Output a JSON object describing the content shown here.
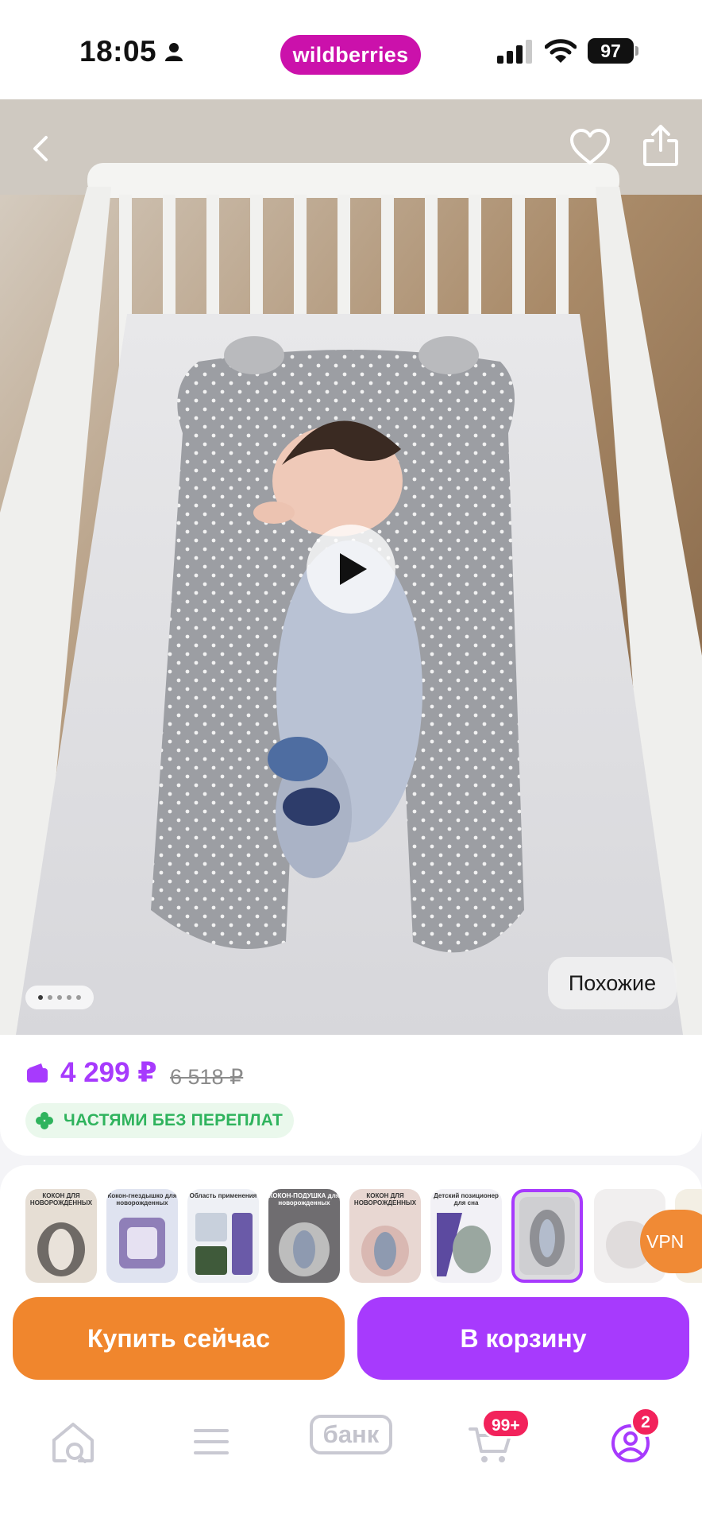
{
  "status_bar": {
    "time": "18:05",
    "brand": "wildberries",
    "battery": "97"
  },
  "product": {
    "price": "4 299 ₽",
    "old_price": "6 518 ₽",
    "installments": "ЧАСТЯМИ БЕЗ ПЕРЕПЛАТ",
    "similar_label": "Похожие"
  },
  "gallery": {
    "total_images": 5,
    "current_index": 1
  },
  "variants": {
    "items": [
      {
        "caption": "КОКОН ДЛЯ НОВОРОЖДЕННЫХ"
      },
      {
        "caption": "Кокон-гнездышко для новорожденных"
      },
      {
        "caption": "Область применения"
      },
      {
        "caption": "КОКОН-ПОДУШКА для новорожденных"
      },
      {
        "caption": "КОКОН ДЛЯ НОВОРОЖДЕННЫХ"
      },
      {
        "caption": "Детский позиционер для сна"
      },
      {
        "caption": ""
      },
      {
        "caption": ""
      }
    ],
    "selected_index": 6
  },
  "vpn_label": "VPN",
  "actions": {
    "buy_now": "Купить сейчас",
    "add_to_cart": "В корзину"
  },
  "nav": {
    "bank_label": "банк",
    "cart_badge": "99+",
    "profile_badge": "2"
  },
  "colors": {
    "brand": "#cb11ab",
    "accent_purple": "#a73afd",
    "accent_orange": "#f0862d",
    "badge_red": "#f2225b",
    "green": "#2fb35d"
  }
}
